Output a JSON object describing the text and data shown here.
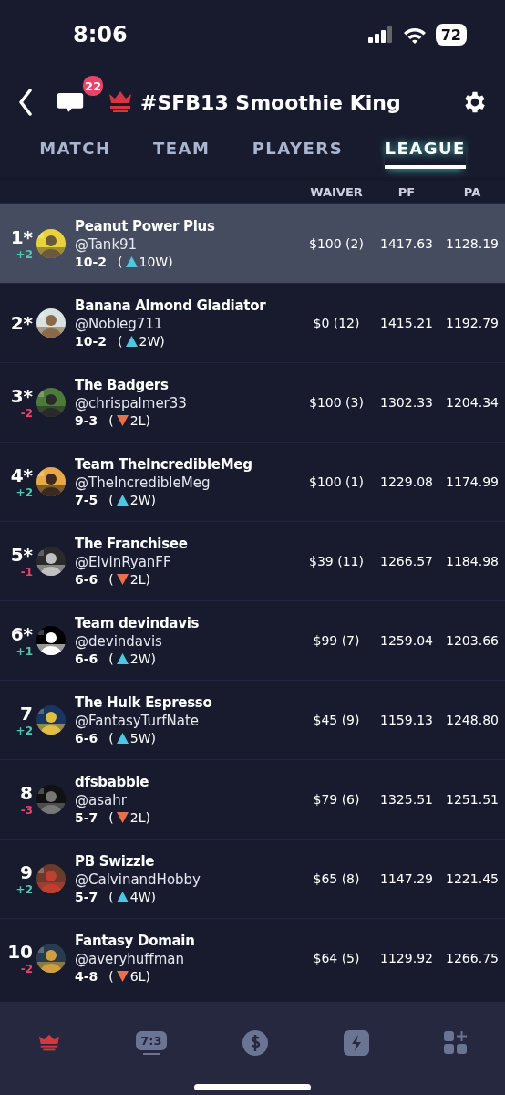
{
  "status_bar": {
    "time": "8:06",
    "battery": "72"
  },
  "header": {
    "dm_badge": "22",
    "title": "#SFB13 Smoothie King"
  },
  "tabs": [
    {
      "label": "MATCH",
      "selected": false
    },
    {
      "label": "TEAM",
      "selected": false
    },
    {
      "label": "PLAYERS",
      "selected": false
    },
    {
      "label": "LEAGUE",
      "selected": true
    }
  ],
  "table": {
    "columns": [
      "WAIVER",
      "PF",
      "PA"
    ],
    "rows": [
      {
        "rank": "1*",
        "change": {
          "text": "+2",
          "color": "#4cc9b0"
        },
        "name": "Peanut Power Plus",
        "handle": "@Tank91",
        "record": "10-2",
        "streak": {
          "open": "(",
          "text": "10W)",
          "rising": true
        },
        "waiver": "$100 (2)",
        "pf": "1417.63",
        "pa": "1128.19",
        "selected": true
      },
      {
        "rank": "2*",
        "name": "Banana Almond Gladiator",
        "handle": "@Nobleg711",
        "record": "10-2",
        "streak": {
          "open": "(",
          "text": "2W)",
          "rising": true
        },
        "waiver": "$0 (12)",
        "pf": "1415.21",
        "pa": "1192.79",
        "selected": false
      },
      {
        "rank": "3*",
        "change": {
          "text": "-2",
          "color": "#e8446a"
        },
        "name": "The Badgers",
        "handle": "@chrispalmer33",
        "record": "9-3",
        "streak": {
          "open": "(",
          "text": "2L)",
          "rising": false
        },
        "waiver": "$100 (3)",
        "pf": "1302.33",
        "pa": "1204.34",
        "selected": false
      },
      {
        "rank": "4*",
        "change": {
          "text": "+2",
          "color": "#4cc9b0"
        },
        "name": "Team TheIncredibleMeg",
        "handle": "@TheIncredibleMeg",
        "record": "7-5",
        "streak": {
          "open": "(",
          "text": "2W)",
          "rising": true
        },
        "waiver": "$100 (1)",
        "pf": "1229.08",
        "pa": "1174.99",
        "selected": false
      },
      {
        "rank": "5*",
        "change": {
          "text": "-1",
          "color": "#e8446a"
        },
        "name": "The Franchisee",
        "handle": "@ElvinRyanFF",
        "record": "6-6",
        "streak": {
          "open": "(",
          "text": "2L)",
          "rising": false
        },
        "waiver": "$39 (11)",
        "pf": "1266.57",
        "pa": "1184.98",
        "selected": false
      },
      {
        "rank": "6*",
        "change": {
          "text": "+1",
          "color": "#4cc9b0"
        },
        "name": "Team devindavis",
        "handle": "@devindavis",
        "record": "6-6",
        "streak": {
          "open": "(",
          "text": "2W)",
          "rising": true
        },
        "waiver": "$99 (7)",
        "pf": "1259.04",
        "pa": "1203.66",
        "selected": false
      },
      {
        "rank": "7",
        "change": {
          "text": "+2",
          "color": "#4cc9b0"
        },
        "name": "The Hulk Espresso",
        "handle": "@FantasyTurfNate",
        "record": "6-6",
        "streak": {
          "open": "(",
          "text": "5W)",
          "rising": true
        },
        "waiver": "$45 (9)",
        "pf": "1159.13",
        "pa": "1248.80",
        "selected": false
      },
      {
        "rank": "8",
        "change": {
          "text": "-3",
          "color": "#e8446a"
        },
        "name": "dfsbabble",
        "handle": "@asahr",
        "record": "5-7",
        "streak": {
          "open": "(",
          "text": "2L)",
          "rising": false
        },
        "waiver": "$79 (6)",
        "pf": "1325.51",
        "pa": "1251.51",
        "selected": false
      },
      {
        "rank": "9",
        "change": {
          "text": "+2",
          "color": "#4cc9b0"
        },
        "name": "PB Swizzle",
        "handle": "@CalvinandHobby",
        "record": "5-7",
        "streak": {
          "open": "(",
          "text": "4W)",
          "rising": true
        },
        "waiver": "$65 (8)",
        "pf": "1147.29",
        "pa": "1221.45",
        "selected": false
      },
      {
        "rank": "10",
        "change": {
          "text": "-2",
          "color": "#e8446a"
        },
        "name": "Fantasy Domain",
        "handle": "@averyhuffman",
        "record": "4-8",
        "streak": {
          "open": "(",
          "text": "6L)",
          "rising": false
        },
        "waiver": "$64 (5)",
        "pf": "1129.92",
        "pa": "1266.75",
        "selected": false
      }
    ]
  },
  "bottom_nav": {
    "score_icon_text": "7:3"
  }
}
